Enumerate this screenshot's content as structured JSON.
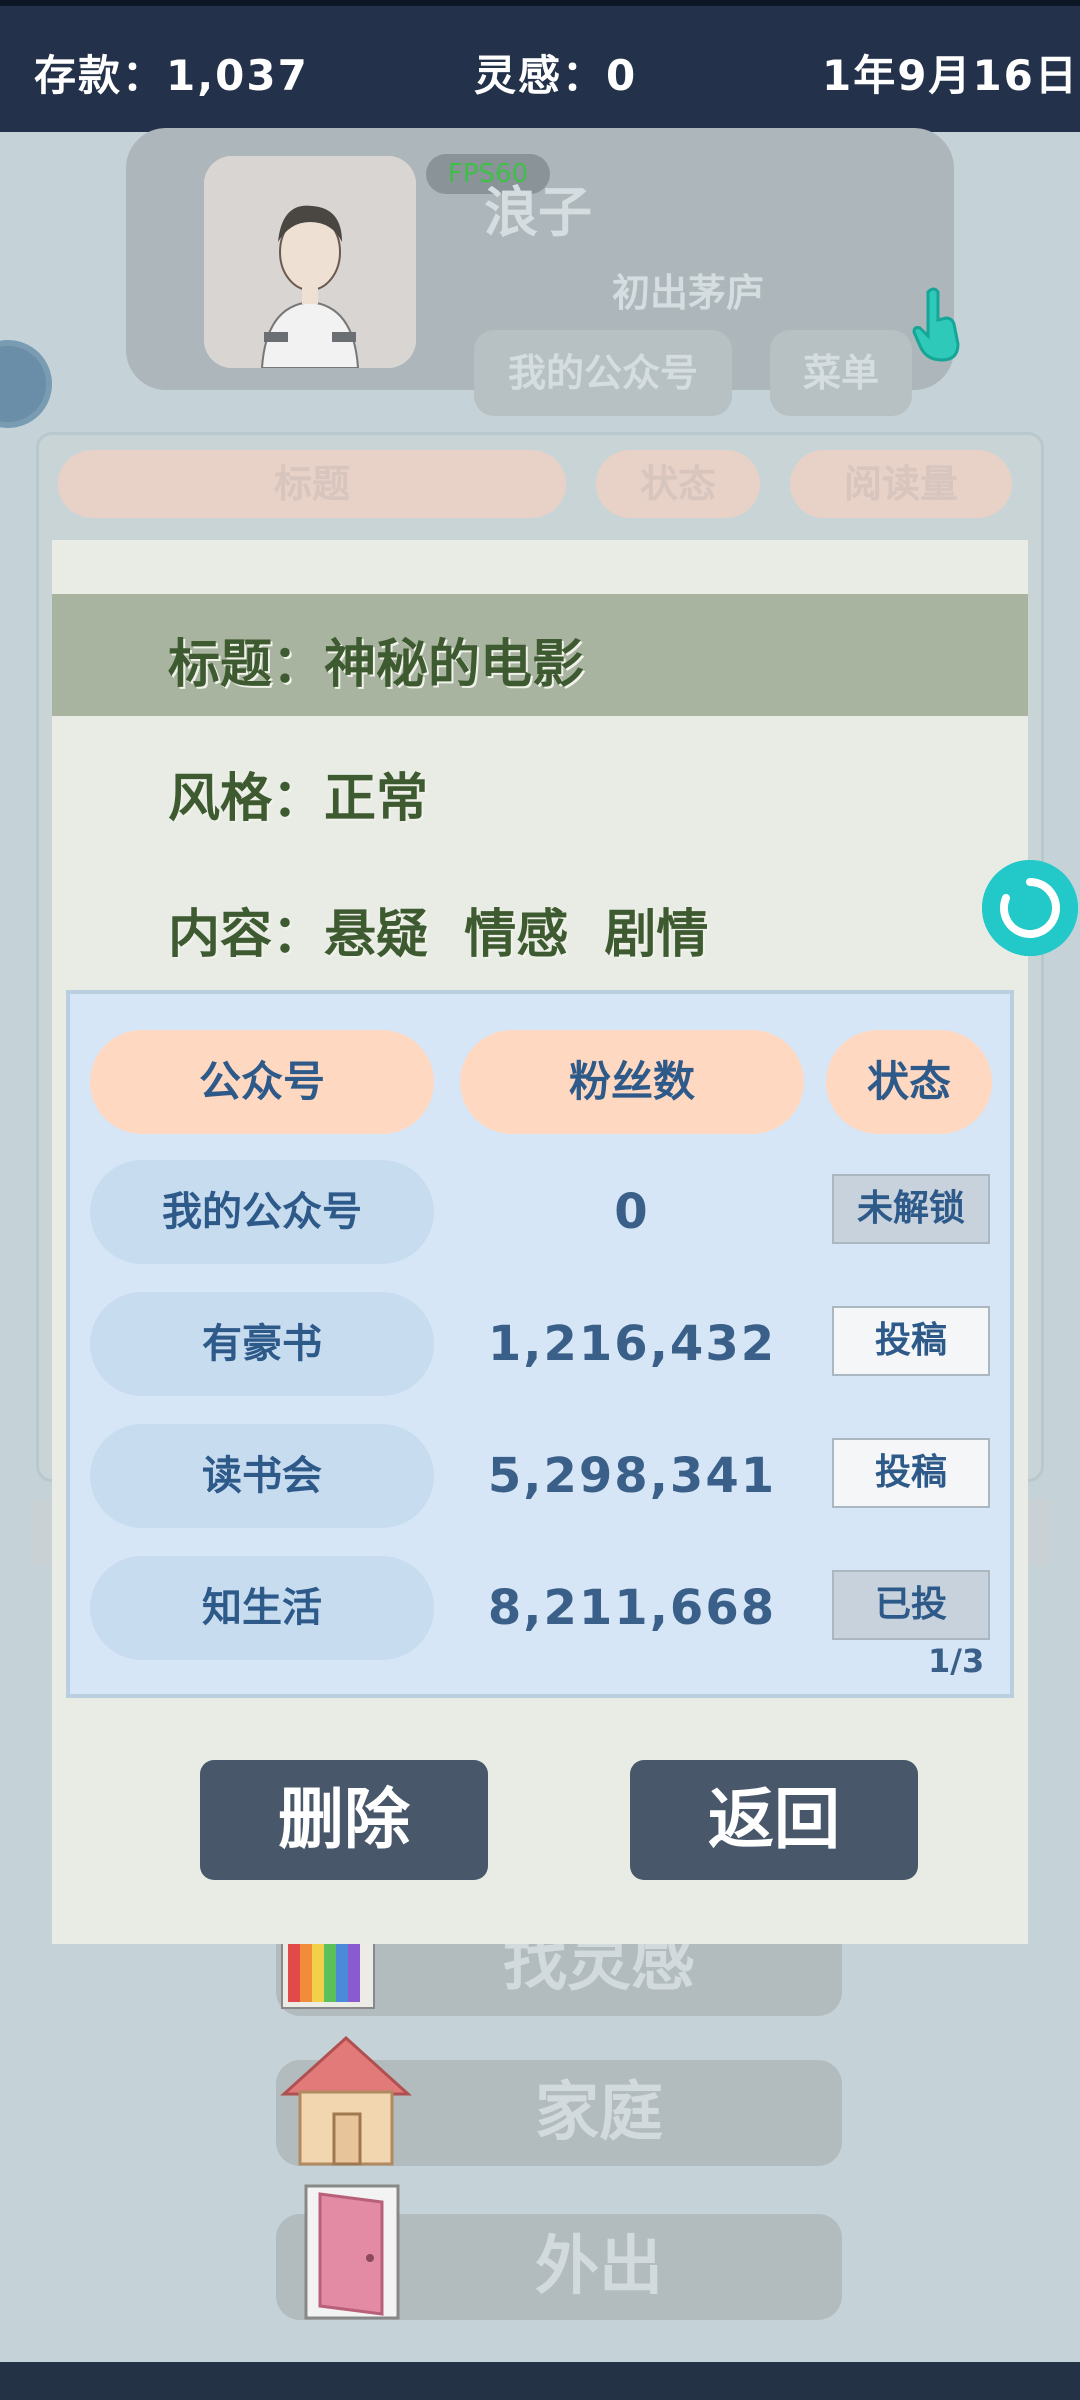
{
  "status_bar": {
    "savings": "存款：1,037",
    "inspiration": "灵感：0",
    "date": "1年9月16日"
  },
  "background": {
    "fps": "FPS60",
    "player_name": "浪子",
    "player_rank": "初出茅庐",
    "my_account_button": "我的公众号",
    "menu_button": "菜单",
    "list_headers": [
      "标题",
      "状态",
      "阅读量"
    ],
    "menu_items": [
      "找灵感",
      "家庭",
      "外出"
    ]
  },
  "dialog": {
    "title_line": "标题：神秘的电影",
    "style_line": "风格：正常",
    "content_line": "内容：悬疑  情感  剧情",
    "table": {
      "headers": [
        "公众号",
        "粉丝数",
        "状态"
      ],
      "rows": [
        {
          "name": "我的公众号",
          "fans": "0",
          "status": "未解锁"
        },
        {
          "name": "有豪书",
          "fans": "1,216,432",
          "status": "投稿"
        },
        {
          "name": "读书会",
          "fans": "5,298,341",
          "status": "投稿"
        },
        {
          "name": "知生活",
          "fans": "8,211,668",
          "status": "已投"
        }
      ],
      "page": "1/3"
    },
    "delete_button": "删除",
    "back_button": "返回"
  }
}
